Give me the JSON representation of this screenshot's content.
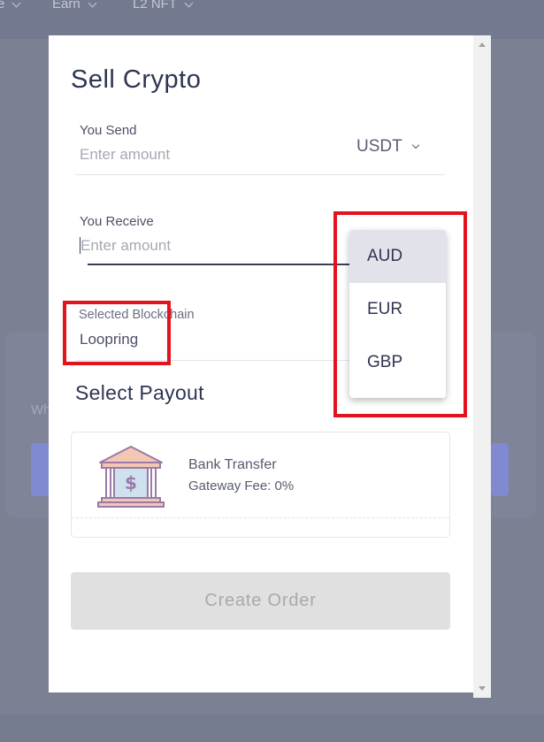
{
  "background": {
    "nav_items": [
      "e",
      "Earn",
      "L2 NFT"
    ],
    "card_text": "Wh"
  },
  "modal": {
    "title": "Sell Crypto",
    "send": {
      "label": "You Send",
      "placeholder": "Enter amount",
      "currency": "USDT"
    },
    "receive": {
      "label": "You Receive",
      "placeholder": "Enter amount"
    },
    "currency_options": [
      "AUD",
      "EUR",
      "GBP"
    ],
    "selected_currency_option": "AUD",
    "blockchain": {
      "label": "Selected Blockchain",
      "value": "Loopring"
    },
    "payout_heading": "Select Payout",
    "payout_method": {
      "name": "Bank Transfer",
      "fee": "Gateway Fee: 0%",
      "icon": "bank-icon"
    },
    "create_order_label": "Create Order"
  },
  "colors": {
    "highlight": "#e3131e",
    "title_text": "#2f3553",
    "disabled_button": "#e0e0e0",
    "dropdown_selected": "#e2e3ea"
  }
}
